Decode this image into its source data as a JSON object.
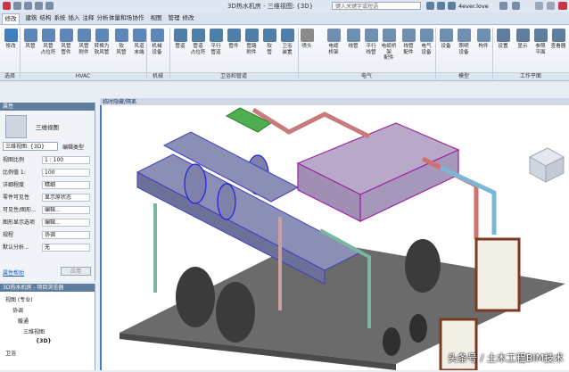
{
  "window": {
    "title": "3D热水机房 - 三维视图: {3D}",
    "search_placeholder": "键入关键字或短语",
    "user": "4ever.love",
    "accent": "#3f7fbf"
  },
  "tabs": [
    "修改",
    "建筑",
    "结构",
    "系统",
    "插入",
    "注释",
    "分析",
    "体量和场地",
    "协作",
    "视图",
    "管理",
    "修改"
  ],
  "ribbon": {
    "buttons": [
      {
        "label": "修改",
        "icon": "cursor-icon"
      },
      {
        "label": "风管",
        "icon": "duct-icon"
      },
      {
        "label": "风管\n占位符",
        "icon": "duct-placeholder-icon"
      },
      {
        "label": "风管\n管件",
        "icon": "duct-fitting-icon"
      },
      {
        "label": "风管\n附件",
        "icon": "duct-accessory-icon"
      },
      {
        "label": "转换为\n软风管",
        "icon": "convert-flex-icon"
      },
      {
        "label": "软\n风管",
        "icon": "flex-duct-icon"
      },
      {
        "label": "风道\n末端",
        "icon": "air-terminal-icon"
      },
      {
        "label": "机械\n设备",
        "icon": "mechanical-equipment-icon"
      },
      {
        "label": "管道",
        "icon": "pipe-icon"
      },
      {
        "label": "管道\n占位符",
        "icon": "pipe-placeholder-icon"
      },
      {
        "label": "平行\n管道",
        "icon": "parallel-pipes-icon"
      },
      {
        "label": "管件",
        "icon": "pipe-fitting-icon"
      },
      {
        "label": "管路\n附件",
        "icon": "pipe-accessory-icon"
      },
      {
        "label": "软\n管",
        "icon": "flex-pipe-icon"
      },
      {
        "label": "卫浴\n装置",
        "icon": "plumbing-fixture-icon"
      },
      {
        "label": "喷头",
        "icon": "sprinkler-icon"
      },
      {
        "label": "电缆\n桥架",
        "icon": "cable-tray-icon"
      },
      {
        "label": "线管",
        "icon": "conduit-icon"
      },
      {
        "label": "平行\n线管",
        "icon": "parallel-conduit-icon"
      },
      {
        "label": "电缆桥架\n配件",
        "icon": "cable-tray-fitting-icon"
      },
      {
        "label": "线管\n配件",
        "icon": "conduit-fitting-icon"
      },
      {
        "label": "电气\n设备",
        "icon": "electrical-equipment-icon"
      },
      {
        "label": "设备",
        "icon": "device-icon"
      },
      {
        "label": "照明\n设备",
        "icon": "lighting-fixture-icon"
      },
      {
        "label": "构件",
        "icon": "component-icon"
      },
      {
        "label": "设置",
        "icon": "settings-icon"
      },
      {
        "label": "显示",
        "icon": "show-icon"
      },
      {
        "label": "参照\n平面",
        "icon": "ref-plane-icon"
      },
      {
        "label": "查看器",
        "icon": "viewer-icon"
      }
    ],
    "groups": [
      "选择",
      "HVAC",
      "机械",
      "卫浴和管道",
      "电气",
      "模型",
      "工作平面"
    ]
  },
  "properties": {
    "header": "属性",
    "type_name": "三维视图",
    "selector": "三维视图: {3D}",
    "edit_type": "编辑类型",
    "rows": [
      {
        "k": "视图比例",
        "v": "1 : 100"
      },
      {
        "k": "比例值 1:",
        "v": "100"
      },
      {
        "k": "详细程度",
        "v": "精细"
      },
      {
        "k": "零件可见性",
        "v": "显示原状态"
      },
      {
        "k": "可见性/图形...",
        "v": "编辑..."
      },
      {
        "k": "图形显示选项",
        "v": "编辑..."
      },
      {
        "k": "规程",
        "v": "协调"
      },
      {
        "k": "默认分析...",
        "v": "无"
      }
    ],
    "help_link": "属性帮助",
    "apply_btn": "应用"
  },
  "browser": {
    "header": "3D热水机房 - 项目浏览器",
    "items": [
      "视图 (专业)",
      "协调",
      "暖通",
      "三维视图",
      "{3D}",
      "卫浴"
    ]
  },
  "viewport": {
    "tab_label": "临时隐藏/隔离"
  },
  "watermark": "头条号 / 土木工程BIM技术"
}
